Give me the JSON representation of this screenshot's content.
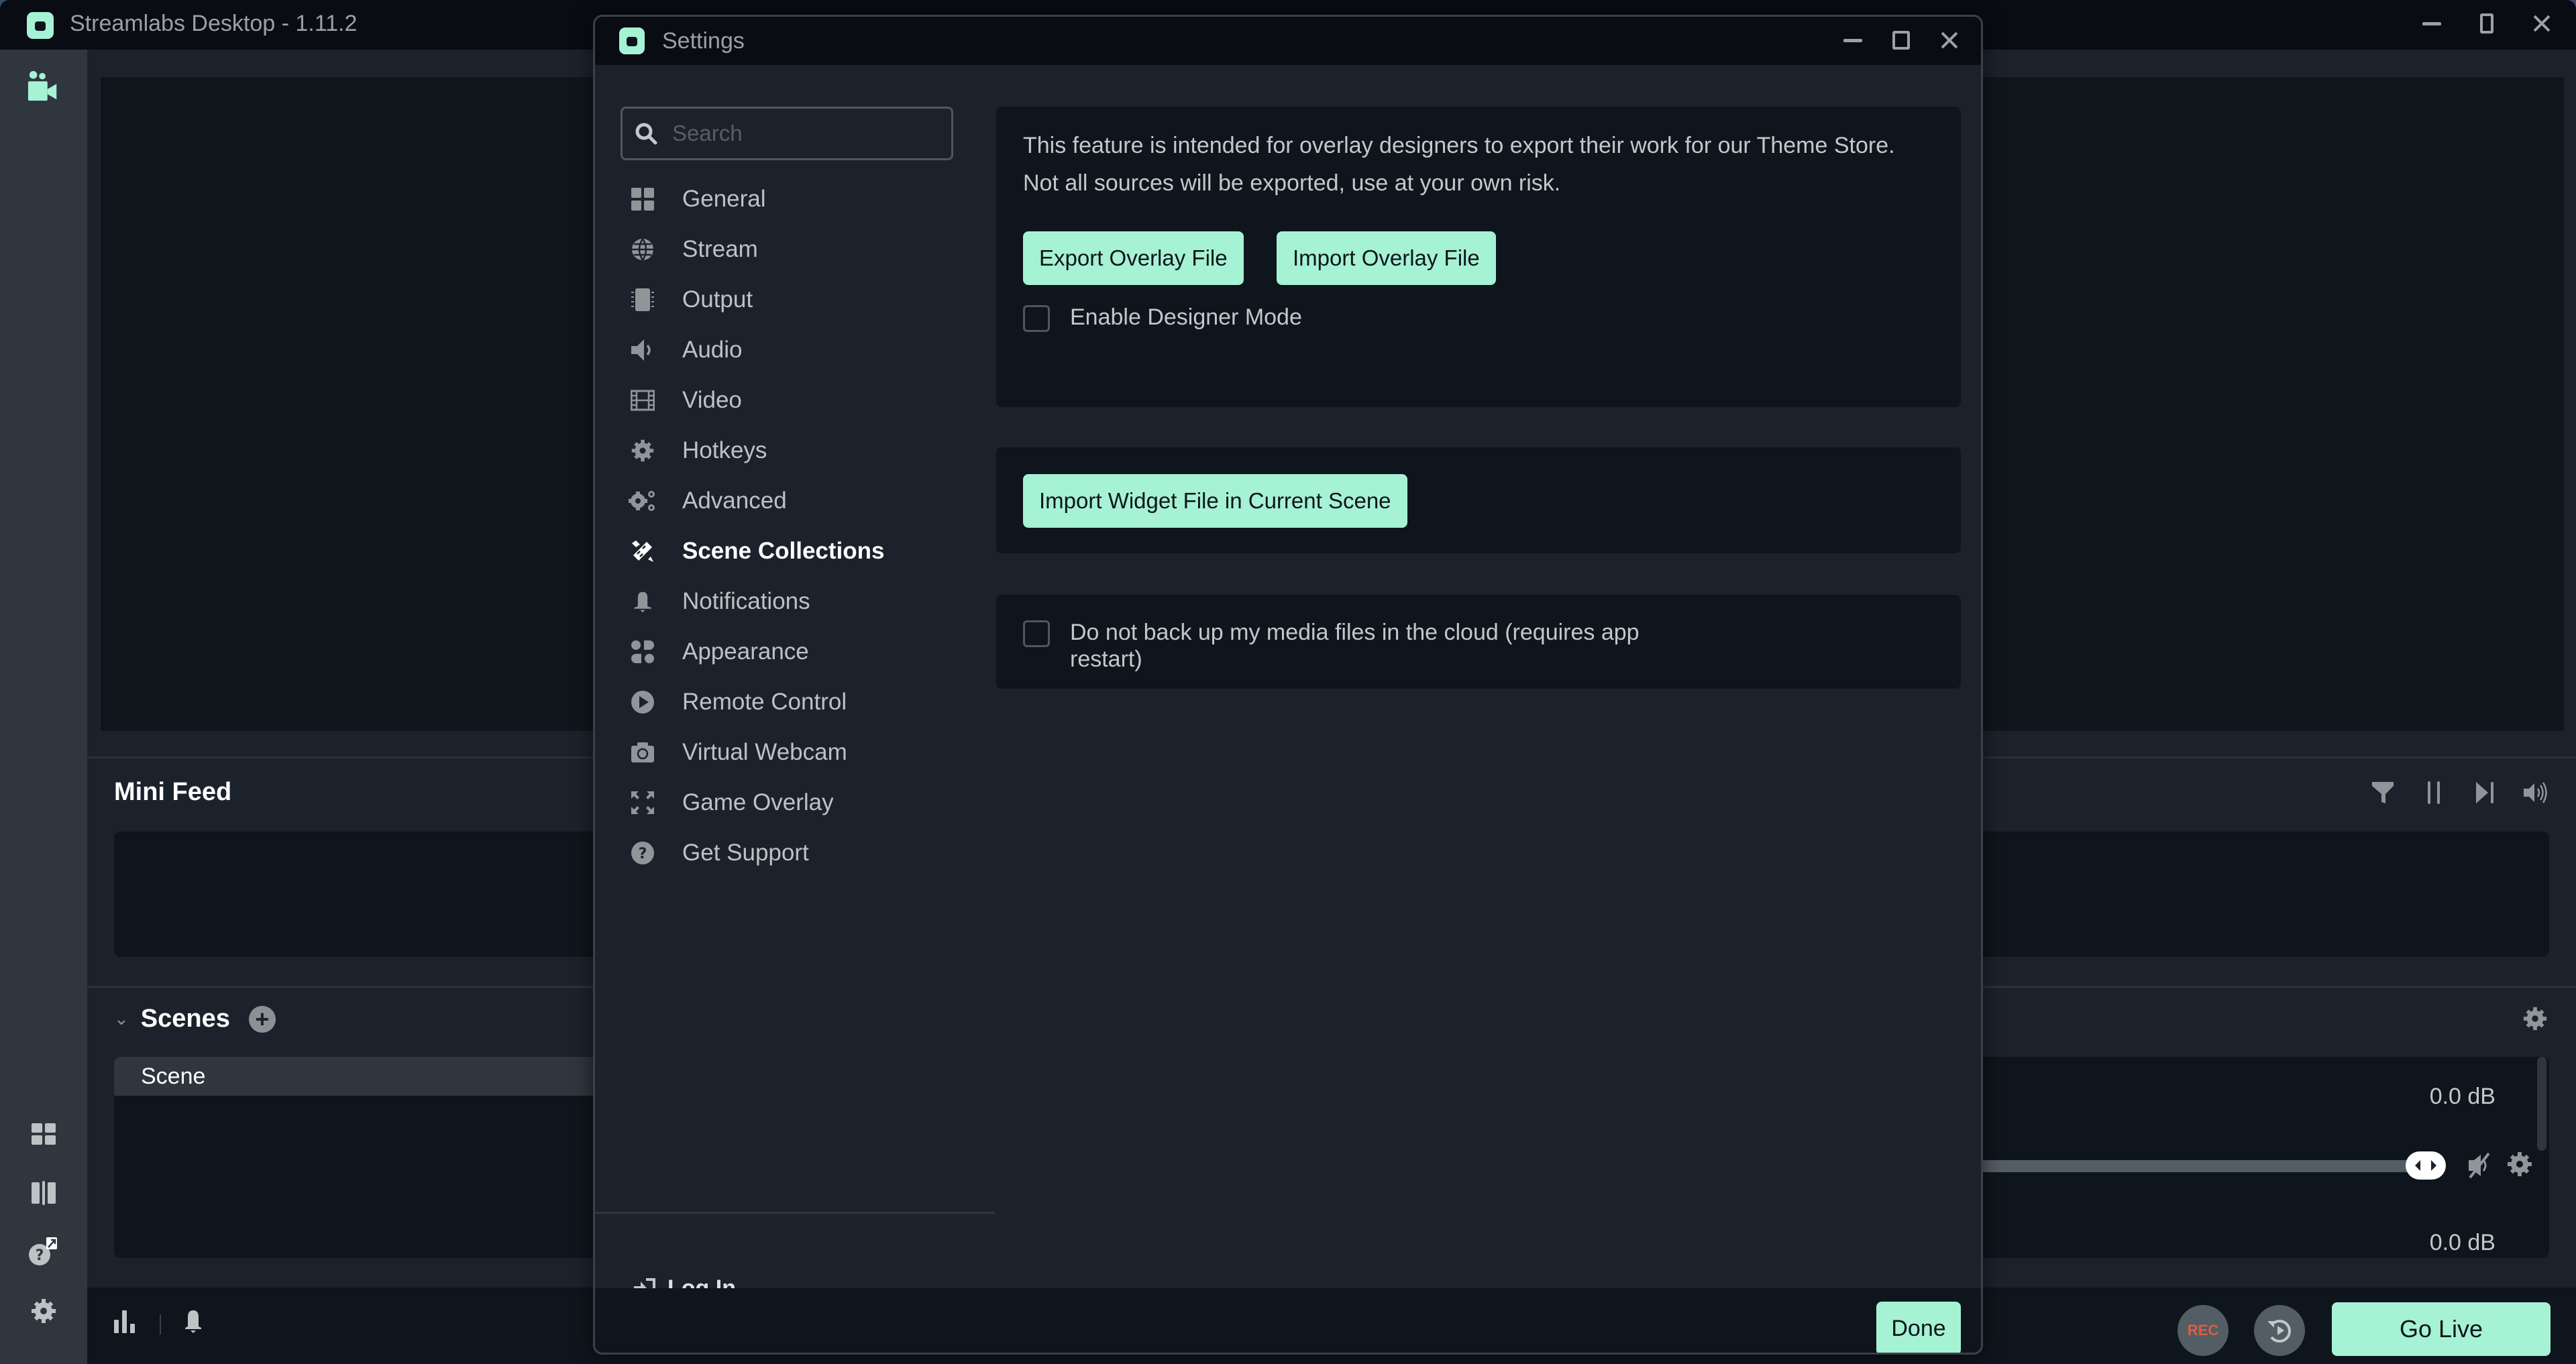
{
  "app": {
    "title": "Streamlabs Desktop - 1.11.2",
    "accent_color": "#a6f2d4"
  },
  "main": {
    "mini_feed": {
      "title": "Mini Feed",
      "controls": [
        "filter-icon",
        "pause-icon",
        "skip-icon",
        "volume-icon"
      ]
    },
    "scenes": {
      "title": "Scenes",
      "items": [
        {
          "label": "Scene",
          "selected": true
        }
      ]
    },
    "mixer": {
      "sources": [
        {
          "db": "0.0 dB"
        },
        {
          "db": "0.0 dB"
        }
      ],
      "volume_fraction": 1.0
    },
    "bottom_bar": {
      "rec_label": "REC",
      "go_live_label": "Go Live"
    }
  },
  "settings": {
    "title": "Settings",
    "search": {
      "placeholder": "Search",
      "value": ""
    },
    "menu": [
      {
        "label": "General",
        "icon": "grid-icon"
      },
      {
        "label": "Stream",
        "icon": "globe-icon"
      },
      {
        "label": "Output",
        "icon": "chip-icon"
      },
      {
        "label": "Audio",
        "icon": "speaker-icon"
      },
      {
        "label": "Video",
        "icon": "film-icon"
      },
      {
        "label": "Hotkeys",
        "icon": "gear-icon"
      },
      {
        "label": "Advanced",
        "icon": "gears-icon"
      },
      {
        "label": "Scene Collections",
        "icon": "ruler-pencil-icon",
        "active": true
      },
      {
        "label": "Notifications",
        "icon": "bell-icon"
      },
      {
        "label": "Appearance",
        "icon": "shapes-icon"
      },
      {
        "label": "Remote Control",
        "icon": "play-circle-icon"
      },
      {
        "label": "Virtual Webcam",
        "icon": "camera-icon"
      },
      {
        "label": "Game Overlay",
        "icon": "expand-icon"
      },
      {
        "label": "Get Support",
        "icon": "question-circle-icon"
      }
    ],
    "login_label": "Log In",
    "done_label": "Done",
    "content": {
      "overlay": {
        "description_line1": "This feature is intended for overlay designers to export their work for our Theme Store.",
        "description_line2": "Not all sources will be exported, use at your own risk.",
        "export_label": "Export Overlay File",
        "import_label": "Import Overlay File",
        "designer_mode_label": "Enable Designer Mode",
        "designer_mode_checked": false
      },
      "widget": {
        "import_widget_label": "Import Widget File in Current Scene"
      },
      "backup": {
        "label_line1": "Do not back up my media files in the cloud (requires app",
        "label_line2": "restart)",
        "checked": false
      }
    }
  }
}
